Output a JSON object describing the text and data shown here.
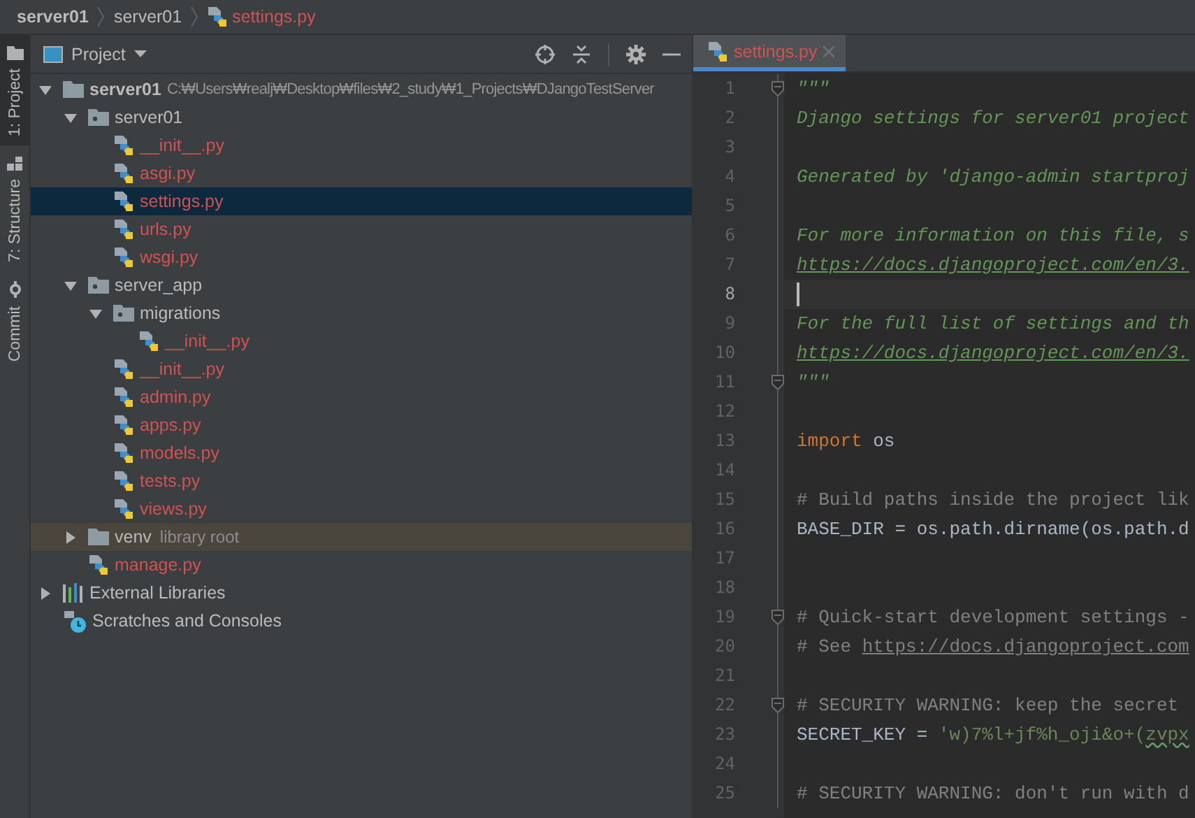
{
  "breadcrumb": [
    {
      "label": "server01",
      "kind": "project"
    },
    {
      "label": "server01",
      "kind": "folder"
    },
    {
      "label": "settings.py",
      "kind": "python-file"
    }
  ],
  "tool_strip": [
    {
      "label": "1: Project",
      "kind": "project",
      "selected": true
    },
    {
      "label": "7: Structure",
      "kind": "structure",
      "selected": false
    },
    {
      "label": "Commit",
      "kind": "commit",
      "selected": false
    }
  ],
  "project_panel": {
    "title": "Project",
    "tree": [
      {
        "label": "server01",
        "kind": "project-root",
        "path": "C:₩Users₩realj₩Desktop₩files₩2_study₩1_Projects₩DJangoTestServer",
        "expanded": true,
        "selected": false,
        "children": [
          {
            "label": "server01",
            "kind": "module-folder",
            "expanded": true,
            "selected": false,
            "children": [
              {
                "label": "__init__.py",
                "kind": "python-file",
                "selected": false
              },
              {
                "label": "asgi.py",
                "kind": "python-file",
                "selected": false
              },
              {
                "label": "settings.py",
                "kind": "python-file",
                "selected": true
              },
              {
                "label": "urls.py",
                "kind": "python-file",
                "selected": false
              },
              {
                "label": "wsgi.py",
                "kind": "python-file",
                "selected": false
              }
            ]
          },
          {
            "label": "server_app",
            "kind": "module-folder",
            "expanded": true,
            "selected": false,
            "children": [
              {
                "label": "migrations",
                "kind": "module-folder",
                "expanded": true,
                "selected": false,
                "children": [
                  {
                    "label": "__init__.py",
                    "kind": "python-file",
                    "selected": false
                  }
                ]
              },
              {
                "label": "__init__.py",
                "kind": "python-file",
                "selected": false
              },
              {
                "label": "admin.py",
                "kind": "python-file",
                "selected": false
              },
              {
                "label": "apps.py",
                "kind": "python-file",
                "selected": false
              },
              {
                "label": "models.py",
                "kind": "python-file",
                "selected": false
              },
              {
                "label": "tests.py",
                "kind": "python-file",
                "selected": false
              },
              {
                "label": "views.py",
                "kind": "python-file",
                "selected": false
              }
            ]
          },
          {
            "label": "venv",
            "kind": "library-folder",
            "hint": "library root",
            "expanded": false,
            "selected": false
          },
          {
            "label": "manage.py",
            "kind": "python-file",
            "selected": false
          }
        ]
      },
      {
        "label": "External Libraries",
        "kind": "external-libraries",
        "expanded": false,
        "selected": false
      },
      {
        "label": "Scratches and Consoles",
        "kind": "scratches",
        "selected": false
      }
    ]
  },
  "editor": {
    "tab": {
      "label": "settings.py",
      "selected": true
    },
    "lines": [
      {
        "number": "1",
        "fold": true,
        "current": false,
        "tokens": [
          {
            "text": "\"\"\"",
            "kind": "docstring"
          }
        ]
      },
      {
        "number": "2",
        "fold": false,
        "current": false,
        "tokens": [
          {
            "text": "Django settings for server01 project",
            "kind": "docstring"
          }
        ]
      },
      {
        "number": "3",
        "fold": false,
        "current": false
      },
      {
        "number": "4",
        "fold": false,
        "current": false,
        "tokens": [
          {
            "text": "Generated by 'django-admin startproj",
            "kind": "docstring"
          }
        ]
      },
      {
        "number": "5",
        "fold": false,
        "current": false
      },
      {
        "number": "6",
        "fold": false,
        "current": false,
        "tokens": [
          {
            "text": "For more information on this file, s",
            "kind": "docstring"
          }
        ]
      },
      {
        "number": "7",
        "fold": false,
        "current": false,
        "tokens": [
          {
            "text": "https://docs.djangoproject.com/en/3.",
            "kind": "doc-link"
          }
        ]
      },
      {
        "number": "8",
        "fold": false,
        "current": true
      },
      {
        "number": "9",
        "fold": false,
        "current": false,
        "tokens": [
          {
            "text": "For the full list of settings and th",
            "kind": "docstring"
          }
        ]
      },
      {
        "number": "10",
        "fold": false,
        "current": false,
        "tokens": [
          {
            "text": "https://docs.djangoproject.com/en/3.",
            "kind": "doc-link"
          }
        ]
      },
      {
        "number": "11",
        "fold": true,
        "current": false,
        "tokens": [
          {
            "text": "\"\"\"",
            "kind": "docstring"
          }
        ]
      },
      {
        "number": "12",
        "fold": false,
        "current": false
      },
      {
        "number": "13",
        "fold": false,
        "current": false,
        "tokens": [
          {
            "text": "import",
            "kind": "keyword"
          },
          {
            "text": " os",
            "kind": "code"
          }
        ]
      },
      {
        "number": "14",
        "fold": false,
        "current": false
      },
      {
        "number": "15",
        "fold": false,
        "current": false,
        "tokens": [
          {
            "text": "# Build paths inside the project lik",
            "kind": "comment"
          }
        ]
      },
      {
        "number": "16",
        "fold": false,
        "current": false,
        "tokens": [
          {
            "text": "BASE_DIR = os.path.dirname(os.path.d",
            "kind": "code"
          }
        ]
      },
      {
        "number": "17",
        "fold": false,
        "current": false
      },
      {
        "number": "18",
        "fold": false,
        "current": false
      },
      {
        "number": "19",
        "fold": true,
        "current": false,
        "tokens": [
          {
            "text": "# Quick-start development settings -",
            "kind": "comment"
          }
        ]
      },
      {
        "number": "20",
        "fold": false,
        "current": false,
        "tokens": [
          {
            "text": "# See ",
            "kind": "comment"
          },
          {
            "text": "https://docs.djangoproject.com",
            "kind": "comment-link"
          }
        ]
      },
      {
        "number": "21",
        "fold": false,
        "current": false
      },
      {
        "number": "22",
        "fold": true,
        "current": false,
        "tokens": [
          {
            "text": "# SECURITY WARNING: keep the secret",
            "kind": "comment"
          }
        ]
      },
      {
        "number": "23",
        "fold": false,
        "current": false,
        "tokens": [
          {
            "text": "SECRET_KEY = ",
            "kind": "code"
          },
          {
            "text": "'w)7%l+jf%h_oji&o+(",
            "kind": "string"
          },
          {
            "text": "zvpx",
            "kind": "string-typo"
          }
        ]
      },
      {
        "number": "24",
        "fold": false,
        "current": false
      },
      {
        "number": "25",
        "fold": false,
        "current": false,
        "tokens": [
          {
            "text": "# SECURITY WARNING: don't run with d",
            "kind": "comment"
          }
        ]
      }
    ]
  }
}
